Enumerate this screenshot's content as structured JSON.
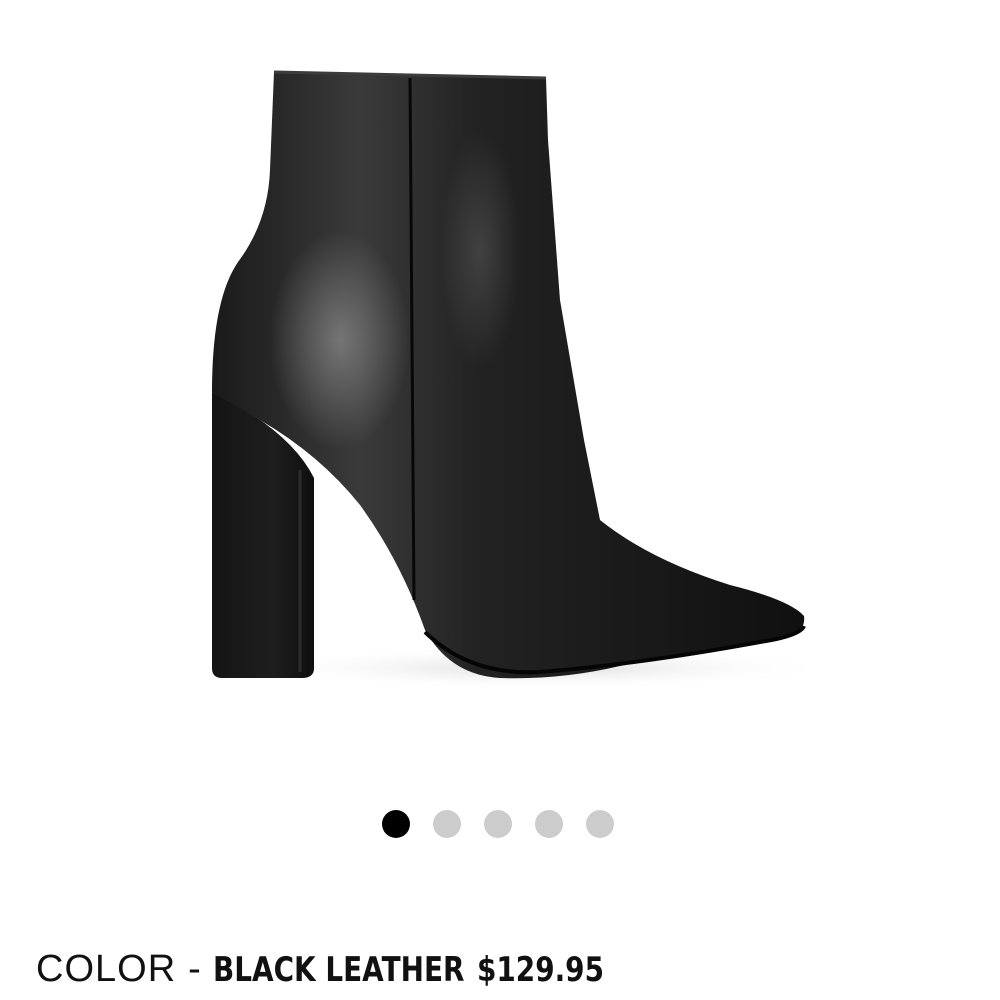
{
  "product": {
    "image_alt": "black leather pointed-toe block heel ankle boot"
  },
  "carousel": {
    "total": 5,
    "active_index": 0
  },
  "details": {
    "color_label": "COLOR",
    "separator": "-",
    "color_value": "BLACK LEATHER",
    "price": "$129.95"
  },
  "colors": {
    "dot_active": "#000000",
    "dot_inactive": "#cccccc",
    "text": "#111111"
  }
}
